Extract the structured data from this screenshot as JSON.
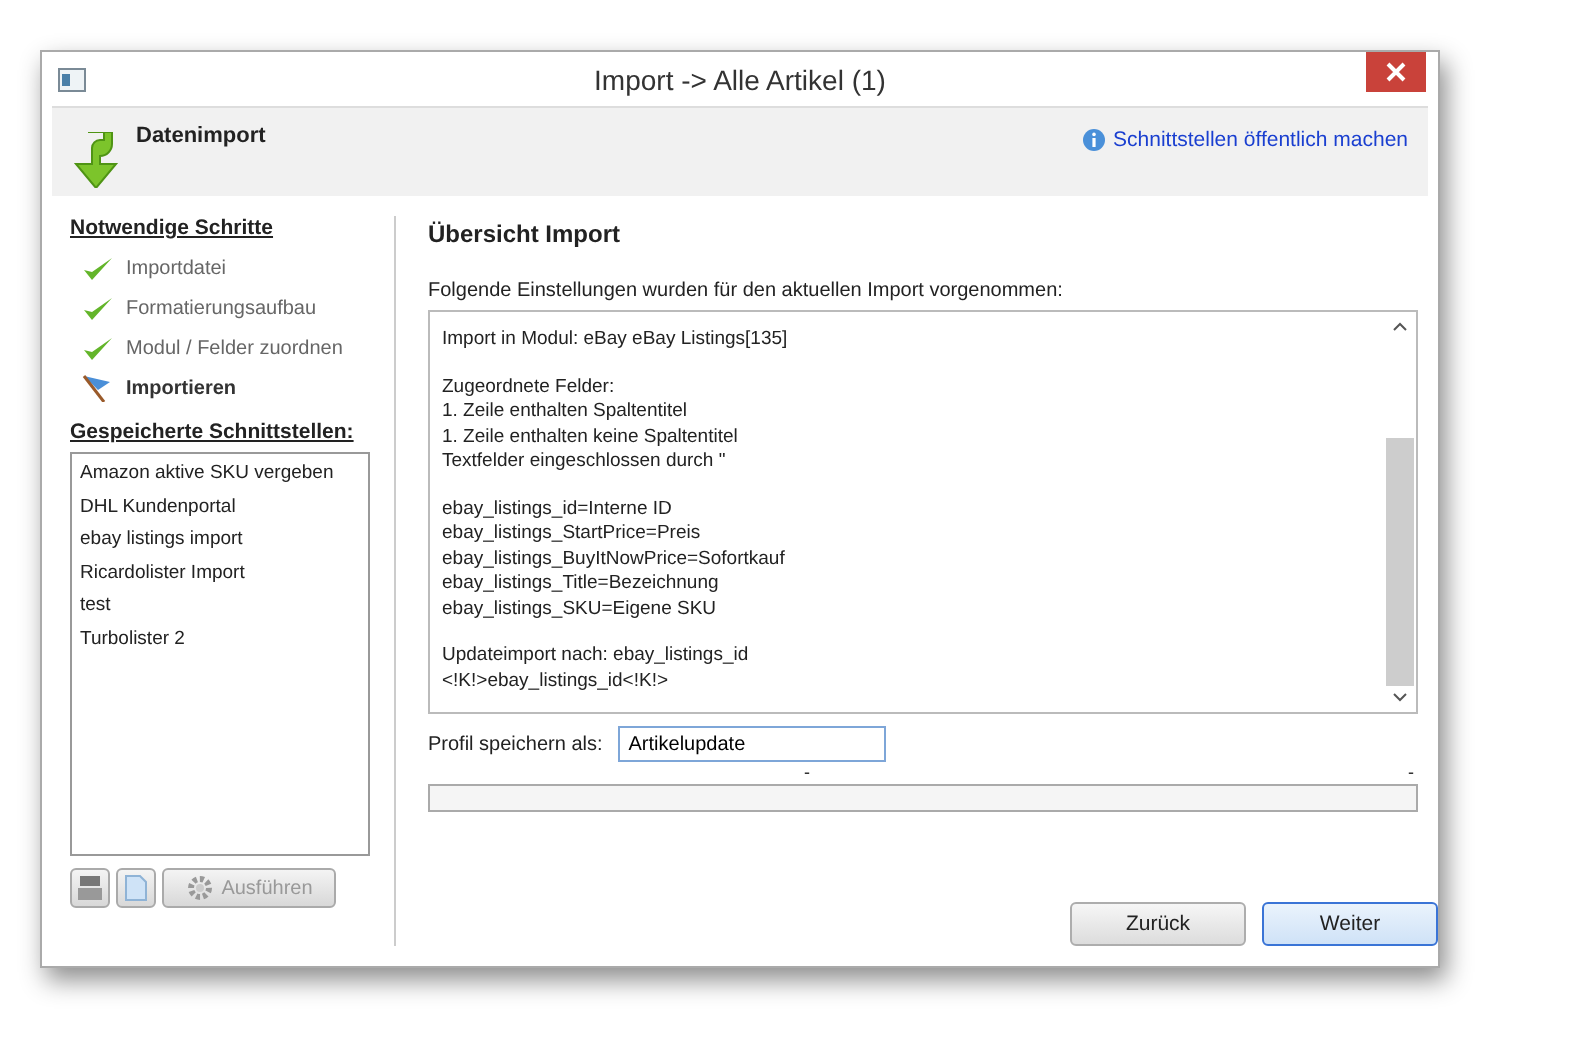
{
  "window": {
    "title": "Import -> Alle Artikel (1)"
  },
  "header": {
    "title": "Datenimport",
    "link": "Schnittstellen öffentlich machen"
  },
  "steps": {
    "heading": "Notwendige Schritte",
    "items": [
      {
        "label": "Importdatei",
        "kind": "done"
      },
      {
        "label": "Formatierungsaufbau",
        "kind": "done"
      },
      {
        "label": "Modul / Felder zuordnen",
        "kind": "done"
      },
      {
        "label": "Importieren",
        "kind": "current"
      }
    ]
  },
  "saved": {
    "heading": "Gespeicherte Schnittstellen:",
    "items": [
      {
        "label": "Amazon aktive SKU vergeben",
        "selected": false
      },
      {
        "label": "DHL Kundenportal",
        "selected": false
      },
      {
        "label": "ebay listings import",
        "selected": false
      },
      {
        "label": "Ricardolister Import",
        "selected": false
      },
      {
        "label": "test",
        "selected": false
      },
      {
        "label": "Turbolister 2",
        "selected": false
      }
    ]
  },
  "left_buttons": {
    "run": {
      "label": "Ausführen",
      "disabled": true
    }
  },
  "main": {
    "title": "Übersicht Import",
    "intro": "Folgende Einstellungen wurden für den aktuellen Import vorgenommen:",
    "summary": [
      [
        "Import in Modul: eBay eBay Listings[135]"
      ],
      [
        "Zugeordnete Felder:",
        "1. Zeile enthalten Spaltentitel",
        "1. Zeile enthalten keine Spaltentitel",
        "Textfelder eingeschlossen durch \""
      ],
      [
        "ebay_listings_id=Interne ID",
        "ebay_listings_StartPrice=Preis",
        "ebay_listings_BuyItNowPrice=Sofortkauf",
        "ebay_listings_Title=Bezeichnung",
        "ebay_listings_SKU=Eigene SKU"
      ],
      [
        "Updateimport nach: ebay_listings_id",
        "<!K!>ebay_listings_id<!K!>"
      ]
    ],
    "profile_label": "Profil speichern als:",
    "profile_value": "Artikelupdate",
    "progress": {
      "left": "-",
      "right": "-",
      "level": 0
    }
  },
  "buttons": [
    {
      "label": "Zurück",
      "selected": false
    },
    {
      "label": "Weiter",
      "selected": true
    }
  ]
}
